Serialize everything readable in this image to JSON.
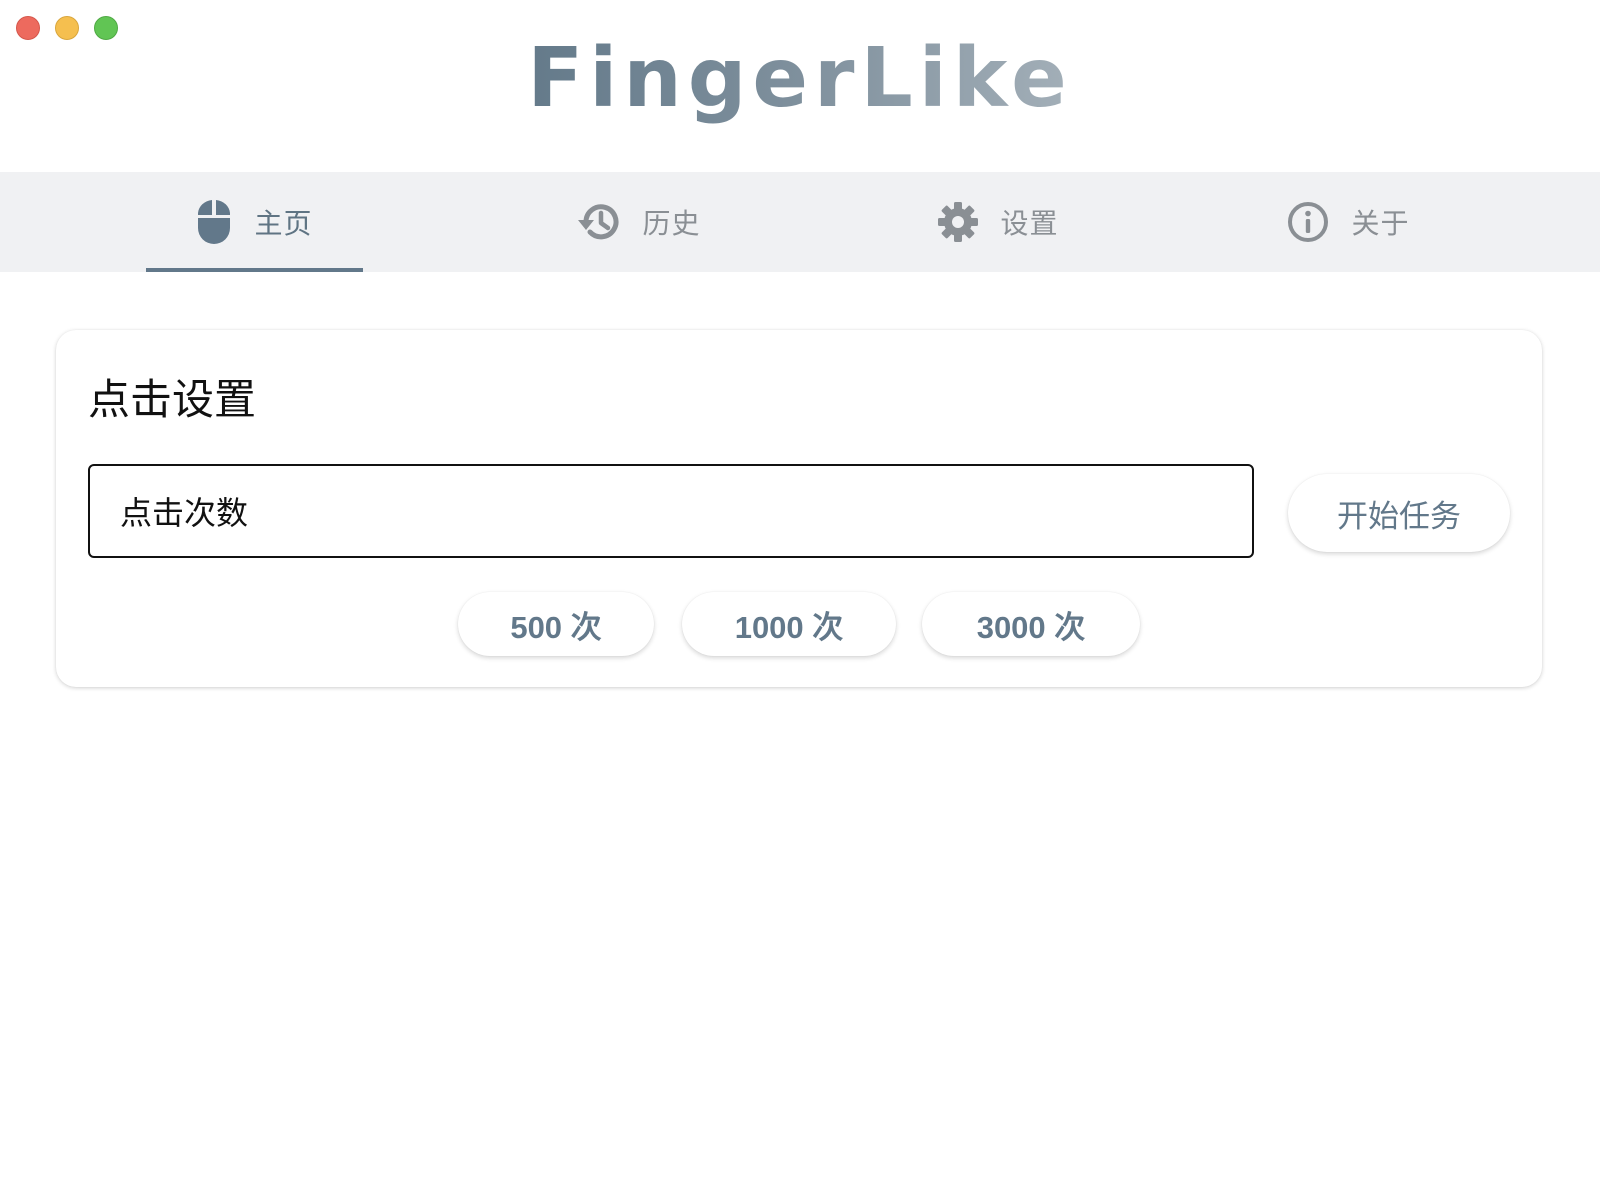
{
  "app": {
    "title": "FingerLike"
  },
  "tabs": [
    {
      "label": "主页",
      "icon": "mouse-icon",
      "active": true
    },
    {
      "label": "历史",
      "icon": "history-icon",
      "active": false
    },
    {
      "label": "设置",
      "icon": "gear-icon",
      "active": false
    },
    {
      "label": "关于",
      "icon": "info-icon",
      "active": false
    }
  ],
  "click_settings": {
    "title": "点击设置",
    "count_field": {
      "label": "点击次数",
      "value": ""
    },
    "start_button": "开始任务",
    "presets": [
      "500 次",
      "1000 次",
      "3000 次"
    ]
  },
  "colors": {
    "accent": "#62788a",
    "tabbar_bg": "#f0f1f3",
    "inactive_tab": "#8a8f94"
  }
}
